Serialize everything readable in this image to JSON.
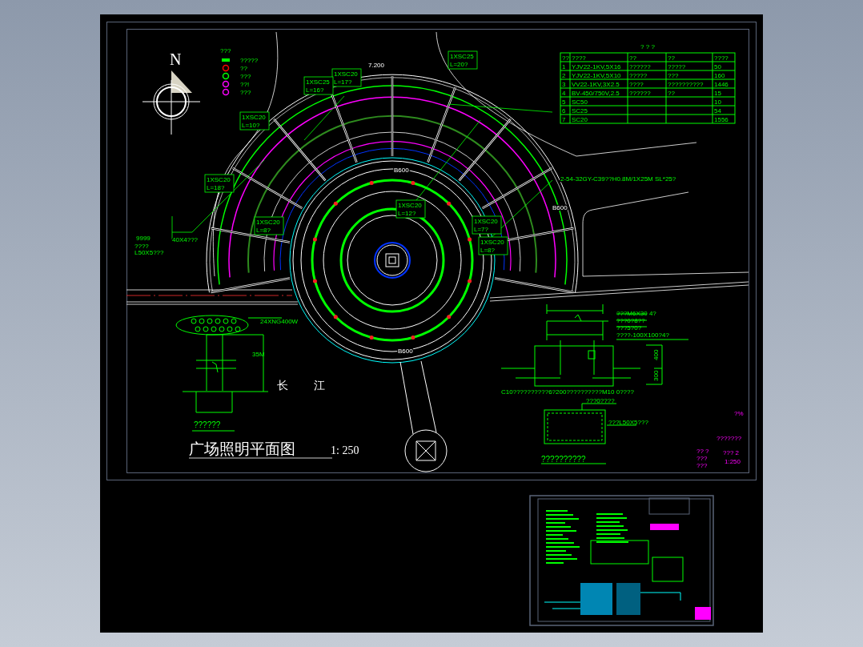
{
  "compass": {
    "label": "N"
  },
  "legend": {
    "title": "???",
    "items": [
      {
        "kind": "bar",
        "color": "#00ff00",
        "label": "?????"
      },
      {
        "kind": "ring",
        "color": "#ff0000",
        "label": "??"
      },
      {
        "kind": "ring",
        "color": "#00ff00",
        "label": "???"
      },
      {
        "kind": "ring",
        "color": "#ff00ff",
        "label": "??!"
      },
      {
        "kind": "ring",
        "color": "#ff00ff",
        "label": "???"
      }
    ]
  },
  "cable_table": {
    "title": "? ? ?",
    "columns": [
      "??",
      "????",
      "??",
      "??",
      "????"
    ],
    "rows": [
      {
        "no": "1",
        "cable": "YJV22-1KV,5X16",
        "col_3": "??????",
        "col_4": "?????",
        "length": "50"
      },
      {
        "no": "2",
        "cable": "YJV22-1KV,5X10",
        "col_3": "?????",
        "col_4": "???",
        "length": "160"
      },
      {
        "no": "3",
        "cable": "VV22-1KV,3X2.5",
        "col_3": "????",
        "col_4": "??????????",
        "length": "1446"
      },
      {
        "no": "4",
        "cable": "BV-450/750V,2.5",
        "col_3": "??????",
        "col_4": "??",
        "length": "15"
      },
      {
        "no": "5",
        "cable": "SC50",
        "length": "10"
      },
      {
        "no": "6",
        "cable": "SC25",
        "length": "54"
      },
      {
        "no": "7",
        "cable": "SC20",
        "length": "1556"
      }
    ]
  },
  "conduit_labels": [
    {
      "code": "1XSC20",
      "length": "L=17?"
    },
    {
      "code": "1XSC25",
      "length": "L=16?"
    },
    {
      "code": "1XSC20",
      "length": "L=10?"
    },
    {
      "code": "1XSC20",
      "length": "L=18?"
    },
    {
      "code": "1XSC20",
      "length": "L=8?"
    },
    {
      "code": "1XSC20",
      "length": "L=12?"
    },
    {
      "code": "1XSC20",
      "length": "L=7?"
    },
    {
      "code": "1XSC20",
      "length": "L=8?"
    },
    {
      "code": "1XSC25",
      "length": "L=20?"
    }
  ],
  "plan_notes": [
    {
      "kind": "green",
      "text": "2-54-32GY-C39??H0.8M/1X25M SL*25?"
    },
    {
      "kind": "white",
      "text": "B600"
    },
    {
      "kind": "white",
      "text": "B600"
    },
    {
      "kind": "white",
      "text": "7.200"
    },
    {
      "kind": "white",
      "text": "B600"
    },
    {
      "kind": "green",
      "text": "9999"
    },
    {
      "kind": "green",
      "text": "40X4???"
    },
    {
      "kind": "green",
      "text": "????"
    },
    {
      "kind": "green",
      "text": "L50X5???"
    }
  ],
  "lamp_detail": {
    "lamp": "24XNG400W",
    "height": "35M",
    "caption": "??????"
  },
  "river": [
    "长",
    "江"
  ],
  "title": {
    "text": "广场照明平面图",
    "scale": "1: 250"
  },
  "foundation_detail": {
    "notes": [
      "???M6X30 4?",
      "???0?8??",
      "???5?0?",
      "????-100X100?4?"
    ],
    "dims": [
      "400",
      "300"
    ],
    "caption": "C10??????????6?200??????????M10 0????",
    "plate_note": "???0????",
    "angle_note": "???L50X5???",
    "plate_caption": "??????????"
  },
  "sheet_info": {
    "mark": "?%",
    "name": "???????",
    "lines": [
      "??  ?",
      "???",
      "???"
    ],
    "number": "??? 2",
    "scale": "1:250"
  }
}
